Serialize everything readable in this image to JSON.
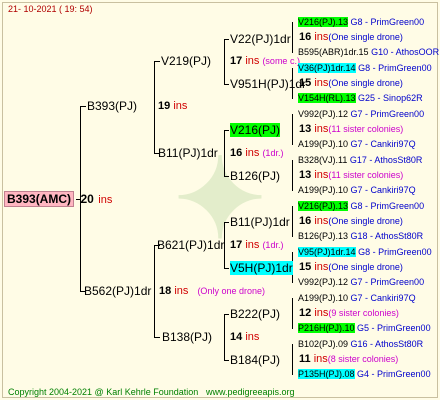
{
  "header": {
    "date_line": "21- 10-2021 ( 19: 54)"
  },
  "footer": {
    "copyright": "Copyright 2004-2021 @ Karl Kehrle Foundation",
    "site": "www.pedigreeapis.org"
  },
  "root": {
    "label": "B393(AMC)",
    "count": "20",
    "ins": "ins"
  },
  "gen1": [
    {
      "label": "B393(PJ)",
      "count": "19",
      "ins": "ins"
    },
    {
      "label": "B562(PJ)1dr",
      "count": "18",
      "ins": "ins",
      "note": "(Only one drone)"
    }
  ],
  "gen2": [
    {
      "label": "V219(PJ)",
      "count": "17",
      "ins": "ins",
      "note": "(some c.)"
    },
    {
      "label": "B11(PJ)1dr",
      "count": "16",
      "ins": "ins",
      "note": "(1dr.)"
    },
    {
      "label": "B621(PJ)1dr",
      "count": "17",
      "ins": "ins",
      "note": "(1dr.)"
    },
    {
      "label": "B138(PJ)",
      "count": "14",
      "ins": "ins"
    }
  ],
  "gen3": [
    {
      "label": "V22(PJ)1dr",
      "count": "16",
      "ins": "ins",
      "note": "(One single drone)"
    },
    {
      "label": "V951H(PJ)1dr",
      "count": "15",
      "ins": "ins",
      "note": "(One single drone)"
    },
    {
      "label": "V216(PJ)",
      "count": "13",
      "ins": "ins",
      "note": "(11 sister colonies)"
    },
    {
      "label": "B126(PJ)",
      "count": "13",
      "ins": "ins",
      "note": "(11 sister colonies)"
    },
    {
      "label": "B11(PJ)1dr",
      "count": "16",
      "ins": "ins",
      "note": "(One single drone)"
    },
    {
      "label": "V5H(PJ)1dr",
      "count": "15",
      "ins": "ins",
      "note": "(One single drone)"
    },
    {
      "label": "B222(PJ)",
      "count": "12",
      "ins": "ins",
      "note": "(9 sister colonies)"
    },
    {
      "label": "B184(PJ)",
      "count": "11",
      "ins": "ins",
      "note": "(8 sister colonies)"
    }
  ],
  "gen4": [
    {
      "label": "V216(PJ).13",
      "tag": "G8 - PrimGreen00"
    },
    {
      "label": "B595(ABR)1dr.15",
      "tag": "G10 - AthosOOR"
    },
    {
      "label": "V36(PJ)1dr.14",
      "tag": "G8 - PrimGreen00"
    },
    {
      "label": "V154H(RL).13",
      "tag": "G25 - Sinop62R"
    },
    {
      "label": "V992(PJ).12",
      "tag": "G7 - PrimGreen00"
    },
    {
      "label": "A199(PJ).10",
      "tag": "G7 - Cankiri97Q"
    },
    {
      "label": "B328(VJ).11",
      "tag": "G17 - AthosSt80R"
    },
    {
      "label": "A199(PJ).10",
      "tag": "G7 - Cankiri97Q"
    },
    {
      "label": "V216(PJ).13",
      "tag": "G8 - PrimGreen00"
    },
    {
      "label": "B126(PJ).13",
      "tag": "G18 - AthosSt80R"
    },
    {
      "label": "V95(PJ)1dr.14",
      "tag": "G8 - PrimGreen00"
    },
    {
      "label": "V992(PJ).12",
      "tag": "G7 - PrimGreen00"
    },
    {
      "label": "A199(PJ).10",
      "tag": "G7 - Cankiri97Q"
    },
    {
      "label": "P216H(PJ).10",
      "tag": "G5 - PrimGreen00"
    },
    {
      "label": "B102(PJ).09",
      "tag": "G16 - AthosSt80R"
    },
    {
      "label": "P135H(PJ).08",
      "tag": "G4 - PrimGreen00"
    }
  ]
}
